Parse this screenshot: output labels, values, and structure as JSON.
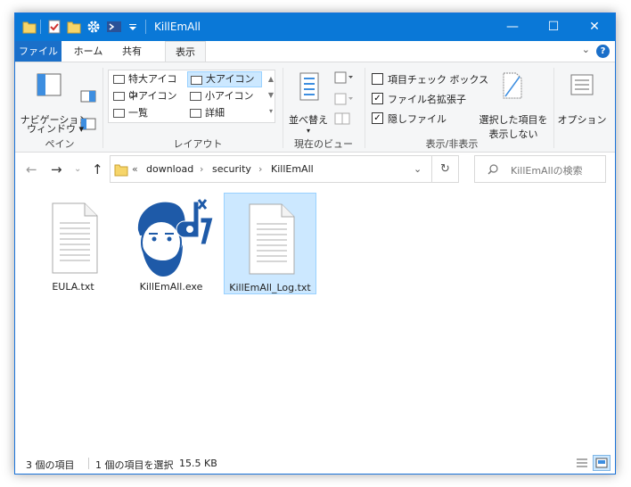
{
  "window": {
    "title": "KillEmAll",
    "controls": {
      "minimize": "—",
      "maximize": "☐",
      "close": "✕"
    }
  },
  "ribbon_tabs": [
    {
      "label": "ファイル"
    },
    {
      "label": "ホーム"
    },
    {
      "label": "共有"
    },
    {
      "label": "表示",
      "active": true
    }
  ],
  "ribbon": {
    "pane_group": {
      "label": "ペイン",
      "nav_pane_line1": "ナビゲーション",
      "nav_pane_line2": "ウィンドウ ▾"
    },
    "layout_group": {
      "label": "レイアウト",
      "items": [
        {
          "label": "特大アイコン"
        },
        {
          "label": "大アイコン",
          "selected": true
        },
        {
          "label": "中アイコン"
        },
        {
          "label": "小アイコン"
        },
        {
          "label": "一覧"
        },
        {
          "label": "詳細"
        }
      ]
    },
    "current_view_group": {
      "label": "現在のビュー",
      "sort_label": "並べ替え"
    },
    "show_hide_group": {
      "label": "表示/非表示",
      "item_checkboxes": {
        "label": "項目チェック ボックス",
        "checked": false
      },
      "file_extensions": {
        "label": "ファイル名拡張子",
        "checked": true
      },
      "hidden_items": {
        "label": "隠しファイル",
        "checked": true
      },
      "hide_selected_line1": "選択した項目を",
      "hide_selected_line2": "表示しない"
    },
    "options_label": "オプション"
  },
  "address": {
    "overflow": "«",
    "path": [
      "download",
      "security",
      "KillEmAll"
    ],
    "search_placeholder": "KillEmAllの検索"
  },
  "files": [
    {
      "name": "EULA.txt",
      "icon": "text-file-icon",
      "selected": false
    },
    {
      "name": "KillEmAll.exe",
      "icon": "killemall-app-icon",
      "selected": false
    },
    {
      "name": "KillEmAll_Log.txt",
      "icon": "text-file-icon",
      "selected": true
    }
  ],
  "status": {
    "item_count": "3 個の項目",
    "selection": "1 個の項目を選択",
    "size": "15.5 KB"
  },
  "colors": {
    "titlebar": "#0a78d7",
    "selection_fill": "#cce8ff",
    "selection_border": "#99d1ff",
    "app_icon_blue": "#1e5aa8"
  }
}
